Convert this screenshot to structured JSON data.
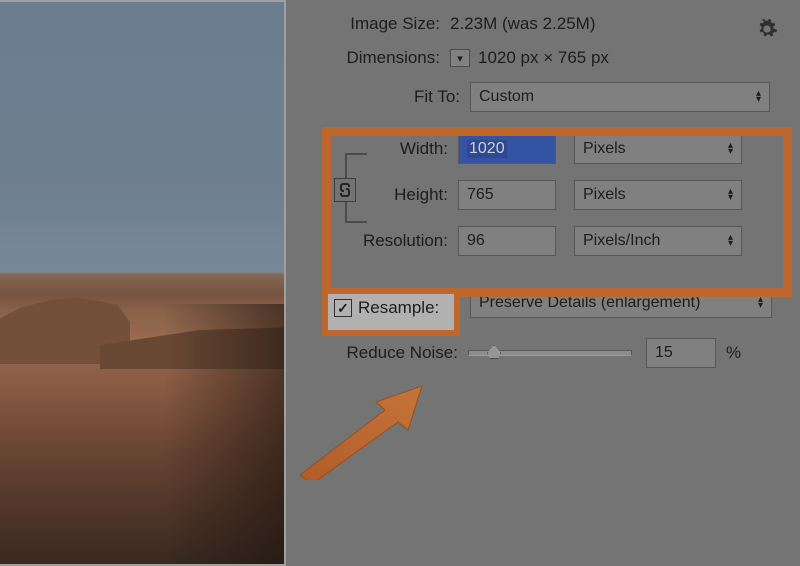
{
  "header": {
    "image_size_label": "Image Size:",
    "image_size_value": "2.23M (was 2.25M)",
    "dimensions_label": "Dimensions:",
    "dimensions_value": "1020 px  ×  765 px",
    "fit_to_label": "Fit To:",
    "fit_to_value": "Custom"
  },
  "fields": {
    "width_label": "Width:",
    "width_value": "1020",
    "width_unit": "Pixels",
    "height_label": "Height:",
    "height_value": "765",
    "height_unit": "Pixels",
    "resolution_label": "Resolution:",
    "resolution_value": "96",
    "resolution_unit": "Pixels/Inch"
  },
  "resample": {
    "label": "Resample:",
    "checked": true,
    "method": "Preserve Details (enlargement)"
  },
  "noise": {
    "label": "Reduce Noise:",
    "value": "15",
    "percent": 15,
    "suffix": "%"
  },
  "icons": {
    "gear": "✱",
    "disclosure": "▾",
    "updown": "▴\n▾",
    "check": "✓",
    "link": "⇅"
  },
  "colors": {
    "highlight": "#e8792f"
  }
}
